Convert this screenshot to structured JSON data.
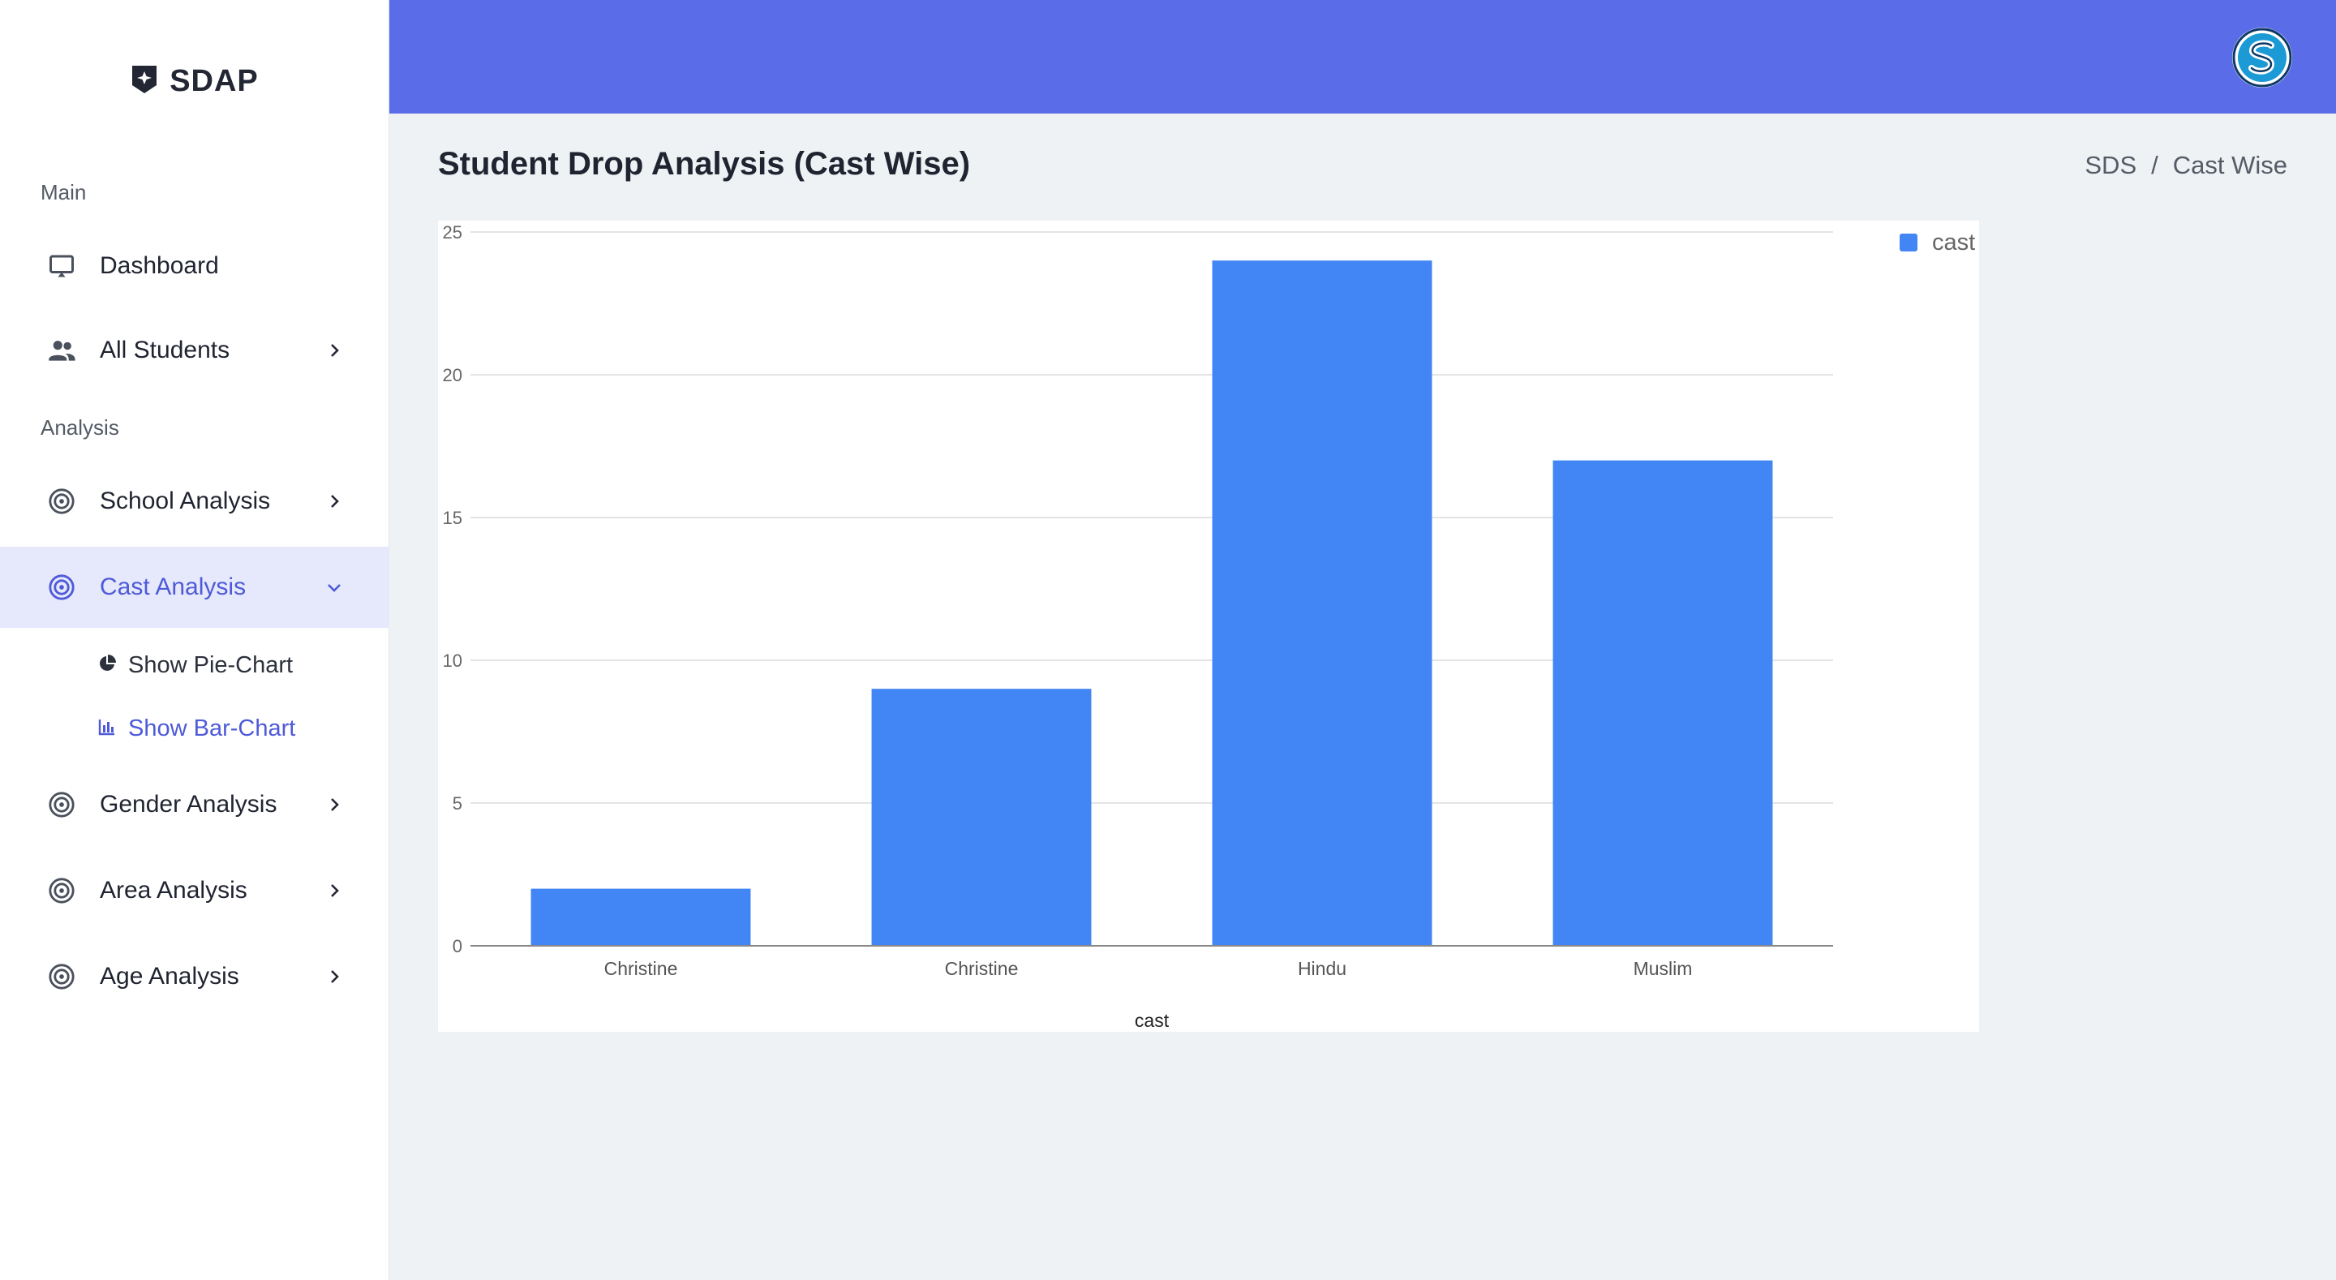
{
  "brand": {
    "name": "SDAP",
    "icon": "shield-plus-icon"
  },
  "sidebar": {
    "sections": [
      {
        "label": "Main"
      },
      {
        "label": "Analysis"
      }
    ],
    "items": [
      {
        "label": "Dashboard",
        "icon": "monitor-icon"
      },
      {
        "label": "All Students",
        "icon": "people-icon"
      },
      {
        "label": "School Analysis",
        "icon": "target-icon"
      },
      {
        "label": "Cast Analysis",
        "icon": "target-icon"
      },
      {
        "label": "Gender Analysis",
        "icon": "target-icon"
      },
      {
        "label": "Area Analysis",
        "icon": "target-icon"
      },
      {
        "label": "Age Analysis",
        "icon": "target-icon"
      }
    ],
    "subitems": [
      {
        "label": "Show Pie-Chart",
        "icon": "pie-chart-icon"
      },
      {
        "label": "Show Bar-Chart",
        "icon": "bar-chart-icon"
      }
    ],
    "active_item": "Cast Analysis",
    "active_subitem": "Show Bar-Chart"
  },
  "header": {
    "title": "Student Drop Analysis (Cast Wise)",
    "breadcrumb": [
      "SDS",
      "/",
      "Cast Wise"
    ]
  },
  "colors": {
    "topbar": "#5b6ce8",
    "accent": "#4e5ad8",
    "bar": "#4285f4"
  },
  "chart_data": {
    "type": "bar",
    "categories": [
      "Christine",
      "Christine",
      "Hindu",
      "Muslim"
    ],
    "series": [
      {
        "name": "cast",
        "values": [
          2,
          9,
          24,
          17
        ]
      }
    ],
    "xlabel": "cast",
    "ylabel": "",
    "ylim": [
      0,
      25
    ],
    "yticks": [
      0,
      5,
      10,
      15,
      20,
      25
    ],
    "grid": true,
    "legend": "top-right"
  }
}
